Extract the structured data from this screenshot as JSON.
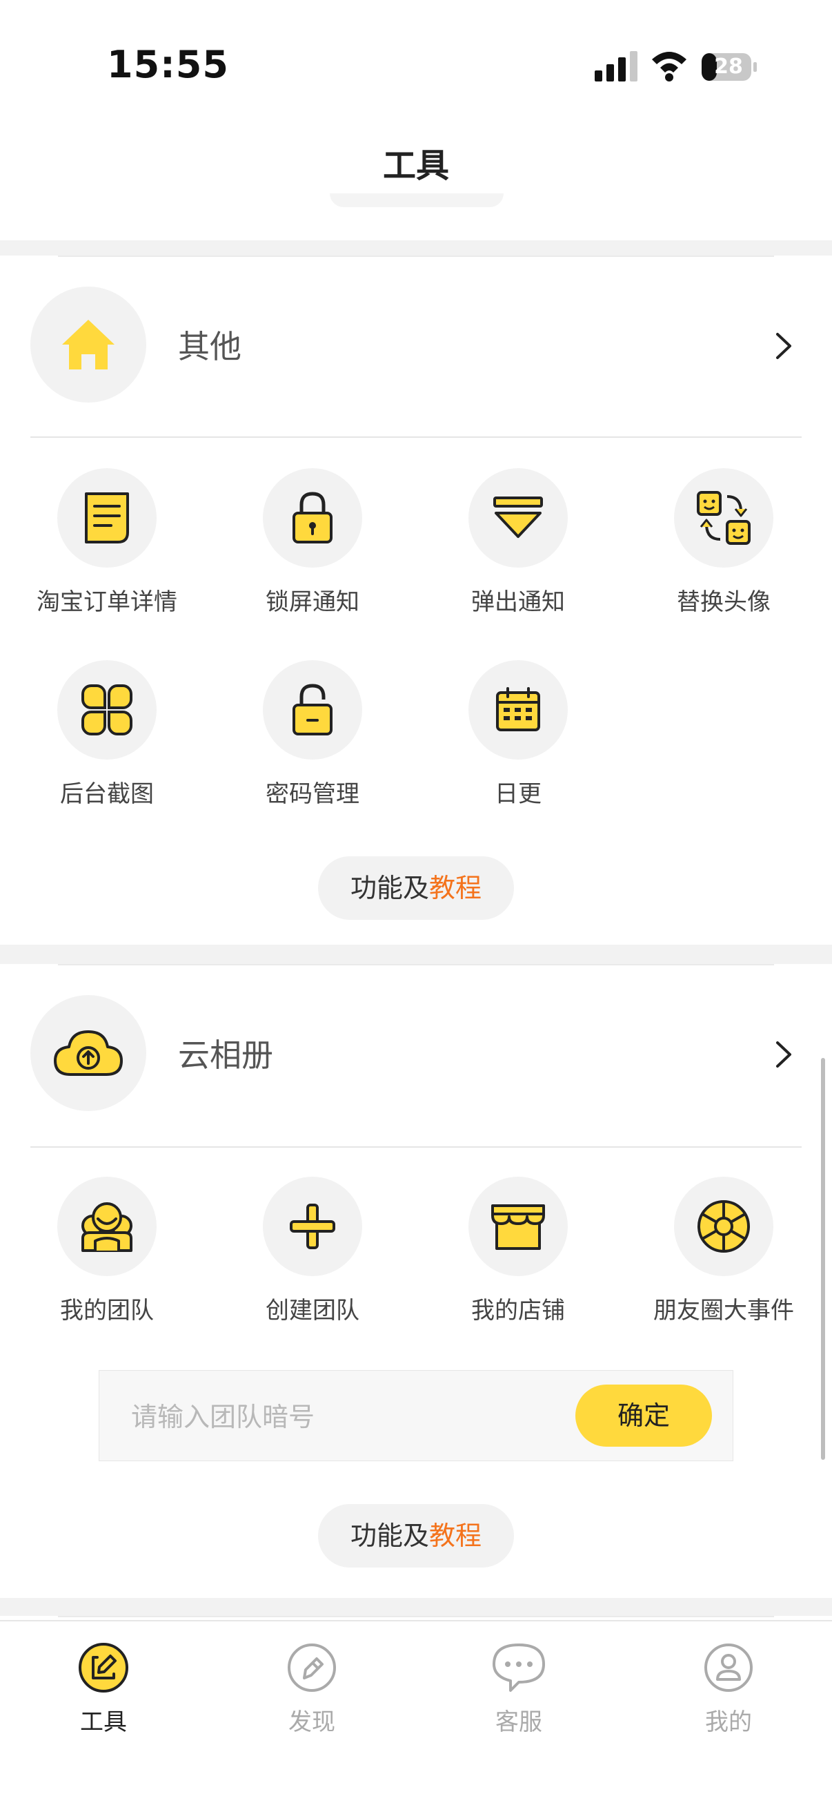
{
  "status": {
    "time": "15:55",
    "battery": "28"
  },
  "header": {
    "title": "工具"
  },
  "section_other": {
    "title": "其他",
    "items": [
      {
        "label": "淘宝订单详情",
        "icon": "note-icon"
      },
      {
        "label": "锁屏通知",
        "icon": "lock-icon"
      },
      {
        "label": "弹出通知",
        "icon": "popup-notification-icon"
      },
      {
        "label": "替换头像",
        "icon": "swap-avatar-icon"
      },
      {
        "label": "后台截图",
        "icon": "four-leaf-icon"
      },
      {
        "label": "密码管理",
        "icon": "unlock-icon"
      },
      {
        "label": "日更",
        "icon": "calendar-icon"
      }
    ],
    "tutorial": {
      "prefix": "功能及",
      "highlight": "教程"
    }
  },
  "section_cloud": {
    "title": "云相册",
    "items": [
      {
        "label": "我的团队",
        "icon": "team-icon"
      },
      {
        "label": "创建团队",
        "icon": "plus-icon"
      },
      {
        "label": "我的店铺",
        "icon": "shop-icon"
      },
      {
        "label": "朋友圈大事件",
        "icon": "aperture-icon"
      }
    ],
    "team_input": {
      "placeholder": "请输入团队暗号",
      "value": ""
    },
    "confirm_label": "确定",
    "tutorial": {
      "prefix": "功能及",
      "highlight": "教程"
    }
  },
  "tabbar": {
    "items": [
      {
        "label": "工具",
        "active": true,
        "icon": "edit-icon"
      },
      {
        "label": "发现",
        "active": false,
        "icon": "discover-icon"
      },
      {
        "label": "客服",
        "active": false,
        "icon": "chat-icon"
      },
      {
        "label": "我的",
        "active": false,
        "icon": "profile-icon"
      }
    ]
  },
  "colors": {
    "accent": "#ffd93d",
    "highlight": "#f4731c",
    "icon_stroke": "#222222"
  }
}
